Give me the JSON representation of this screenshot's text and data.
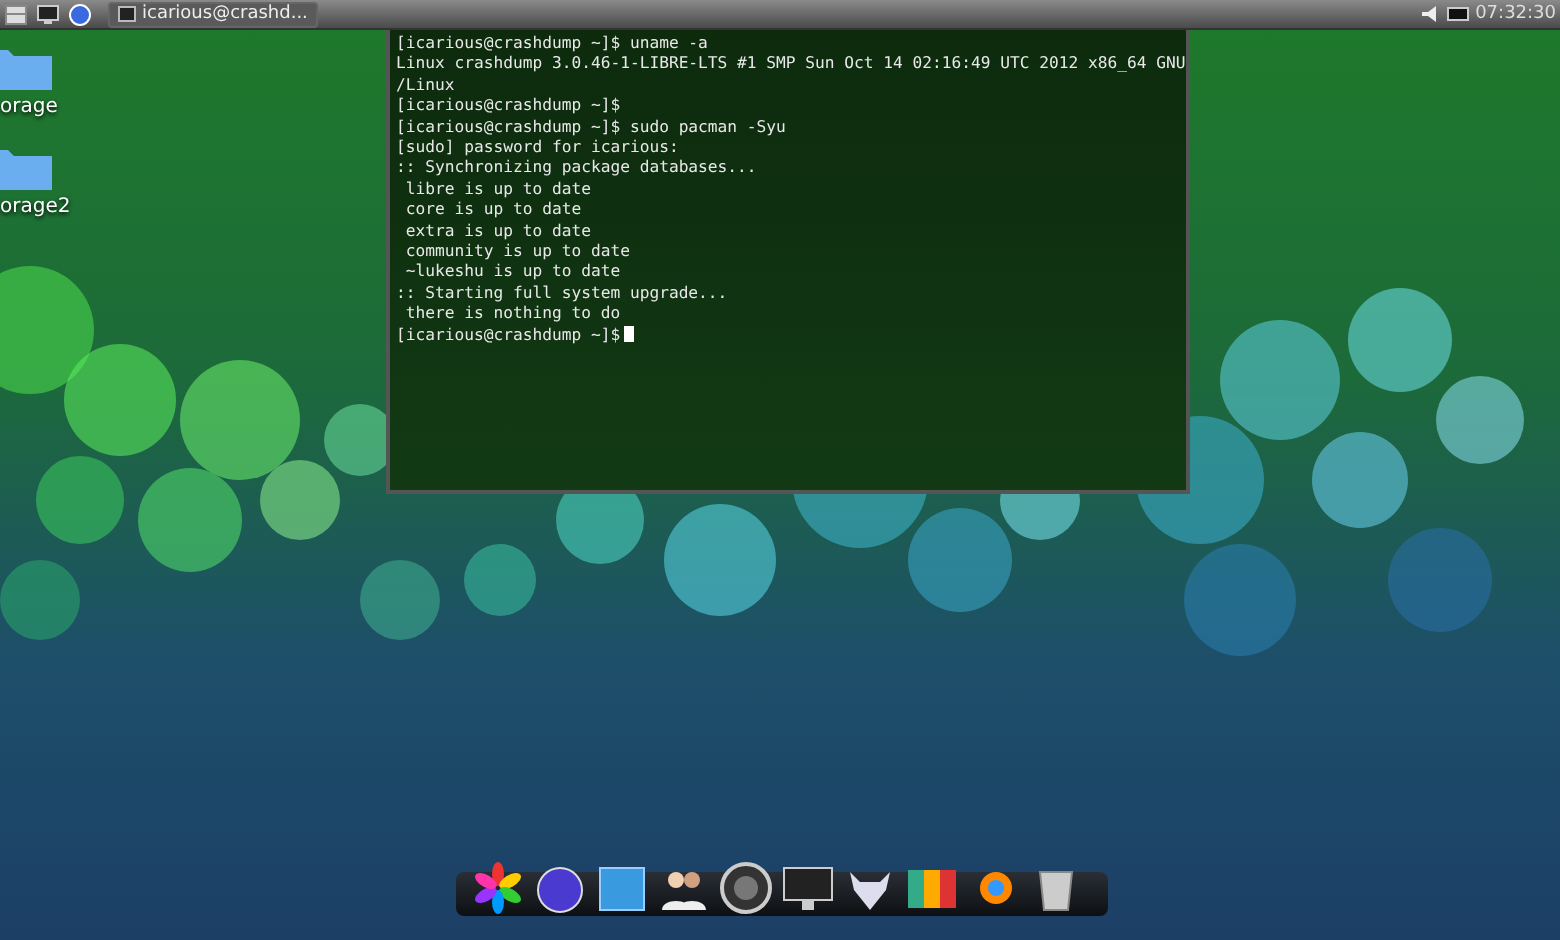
{
  "panel": {
    "tasks": [
      {
        "label": "icarious@crashd...",
        "selected": false
      }
    ],
    "clock": "07:32:30"
  },
  "desktop_icons": [
    {
      "label": "orage"
    },
    {
      "label": "orage2"
    }
  ],
  "terminal": {
    "lines": [
      "[icarious@crashdump ~]$ uname -a",
      "Linux crashdump 3.0.46-1-LIBRE-LTS #1 SMP Sun Oct 14 02:16:49 UTC 2012 x86_64 GNU",
      "/Linux",
      "[icarious@crashdump ~]$",
      "[icarious@crashdump ~]$ sudo pacman -Syu",
      "[sudo] password for icarious:",
      ":: Synchronizing package databases...",
      " libre is up to date",
      " core is up to date",
      " extra is up to date",
      " community is up to date",
      " ~lukeshu is up to date",
      ":: Starting full system upgrade...",
      " there is nothing to do"
    ],
    "prompt": "[icarious@crashdump ~]$",
    "cursor": true
  }
}
